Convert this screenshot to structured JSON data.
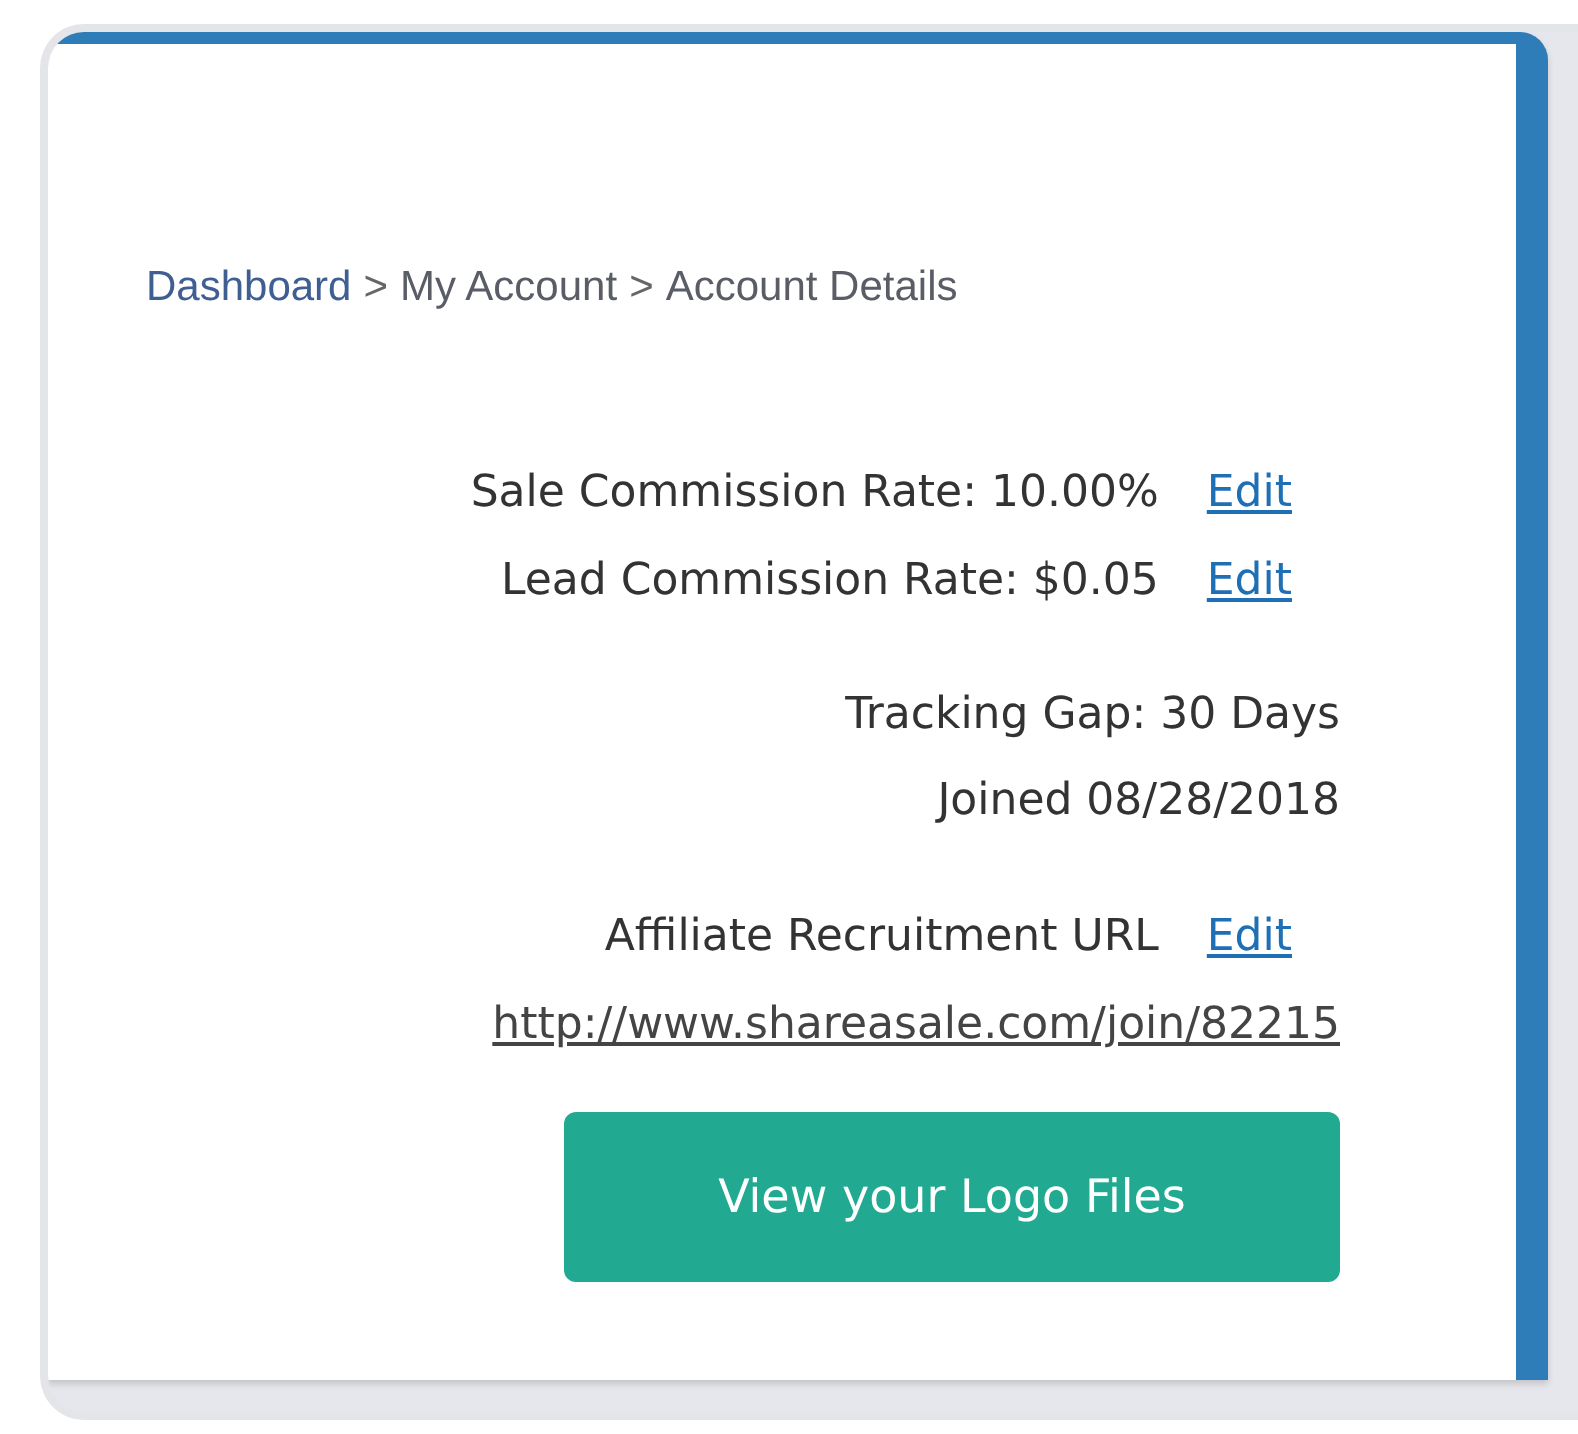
{
  "breadcrumb": [
    {
      "kind": "link",
      "text": "Dashboard"
    },
    {
      "kind": "separator",
      "text": ">"
    },
    {
      "kind": "crumb",
      "text": "My Account"
    },
    {
      "kind": "separator",
      "text": ">"
    },
    {
      "kind": "crumb",
      "text": "Account Details"
    }
  ],
  "rates": [
    {
      "label": "Sale Commission Rate: 10.00%",
      "action": "Edit"
    },
    {
      "label": "Lead Commission Rate: $0.05",
      "action": "Edit"
    }
  ],
  "info": [
    "Tracking Gap: 30 Days",
    "Joined 08/28/2018"
  ],
  "recruitment": {
    "label": "Affiliate Recruitment URL",
    "action": "Edit",
    "url": "http://www.shareasale.com/join/82215"
  },
  "button": "View your Logo Files"
}
